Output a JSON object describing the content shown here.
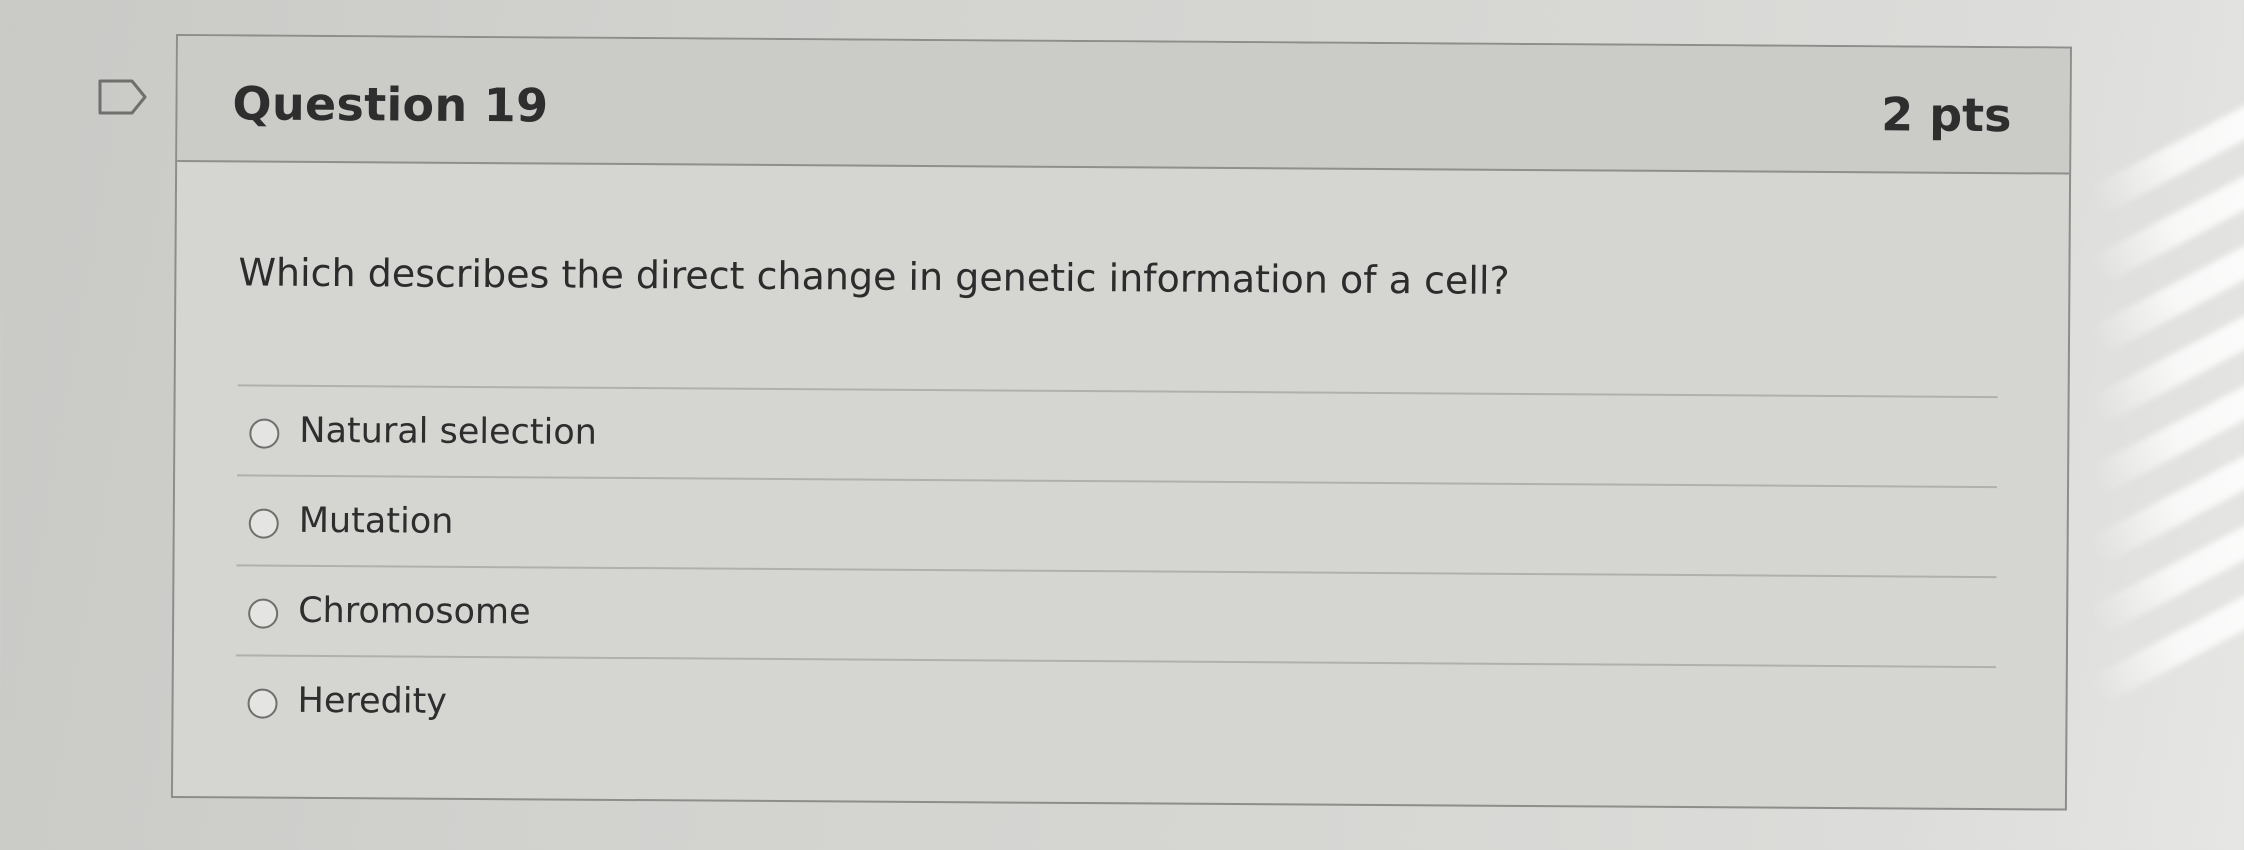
{
  "question": {
    "title": "Question 19",
    "points": "2 pts",
    "text": "Which describes the direct change in genetic information of a cell?",
    "answers": [
      {
        "label": "Natural selection",
        "selected": false
      },
      {
        "label": "Mutation",
        "selected": false
      },
      {
        "label": "Chromosome",
        "selected": false
      },
      {
        "label": "Heredity",
        "selected": false
      }
    ]
  },
  "icons": {
    "flag": "flag-icon",
    "radio": "radio-button-icon"
  },
  "colors": {
    "header_bg": "#cbcbc8",
    "card_bg": "#d5d5d2",
    "border": "#8d8d8a",
    "text": "#2e2e2e"
  }
}
